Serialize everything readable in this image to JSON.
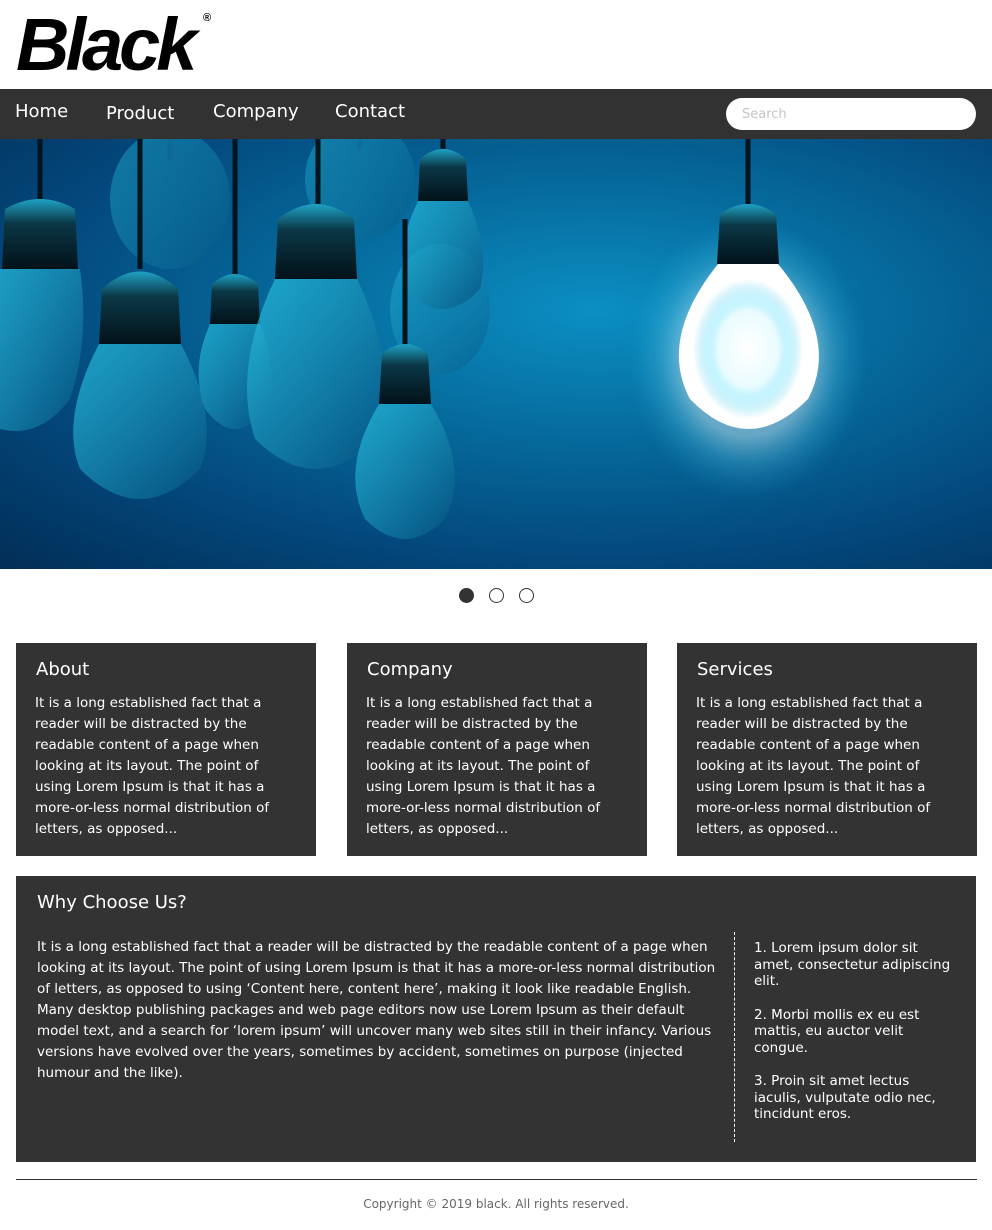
{
  "brand": {
    "logo_text": "Black",
    "registered_mark": "®"
  },
  "nav": {
    "items": [
      {
        "label": "Home"
      },
      {
        "label": "Product"
      },
      {
        "label": "Company"
      },
      {
        "label": "Contact"
      }
    ],
    "search_placeholder": "Search"
  },
  "hero": {
    "image": "light-bulbs-illustration",
    "slide_count": 3,
    "active_slide": 1
  },
  "cards": [
    {
      "title": "About",
      "body": "It is a long established fact that a reader will be distracted by the readable content of a page when looking at its layout. The point of using Lorem Ipsum is that it has a more-or-less normal distribution of letters, as opposed..."
    },
    {
      "title": "Company",
      "body": "It is a long established fact that a reader will be distracted by the readable content of a page when looking at its layout. The point of using Lorem Ipsum is that it has a more-or-less normal distribution of letters, as opposed..."
    },
    {
      "title": "Services",
      "body": "It is a long established fact that a reader will be distracted by the readable content of a page when looking at its layout. The point of using Lorem Ipsum is that it has a more-or-less normal distribution of letters, as opposed..."
    }
  ],
  "why": {
    "title": "Why Choose Us?",
    "body": "It is a long established fact that a reader will be distracted by the readable content of a page when looking at its layout. The point of using Lorem Ipsum is that it has a more-or-less normal distribution of letters, as opposed to using ‘Content here, content here’, making it look like readable English. Many desktop publishing packages and web page editors now use Lorem Ipsum as their default model text, and a search for ‘lorem ipsum’ will uncover many web sites still in their infancy. Various versions have evolved over the years, sometimes by accident, sometimes on purpose (injected humour and the like).",
    "list": [
      "1. Lorem ipsum dolor sit amet, consectetur adipiscing elit.",
      "2. Morbi mollis ex eu est mattis, eu auctor velit congue.",
      "3. Proin sit amet lectus iaculis, vulputate odio nec, tincidunt eros."
    ]
  },
  "footer": {
    "copyright": "Copyright © 2019 black. All rights reserved."
  },
  "colors": {
    "nav_bg": "#323232",
    "card_bg": "#333333",
    "hero_blue": "#066a9c",
    "text_light": "#ffffff"
  }
}
